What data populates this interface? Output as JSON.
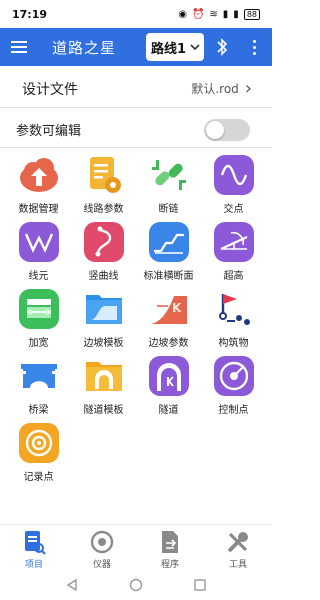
{
  "status": {
    "time": "17:19",
    "battery": "88"
  },
  "appbar": {
    "title": "道路之星",
    "route": "路线1"
  },
  "design": {
    "label": "设计文件",
    "value": "默认.rod"
  },
  "edit": {
    "label": "参数可编辑"
  },
  "grid": {
    "items": [
      {
        "label": "数据管理",
        "icon": "cloud-upload-icon"
      },
      {
        "label": "线路参数",
        "icon": "document-gear-icon"
      },
      {
        "label": "断链",
        "icon": "broken-chain-icon"
      },
      {
        "label": "交点",
        "icon": "sine-wave-icon"
      },
      {
        "label": "线元",
        "icon": "curve-line-icon"
      },
      {
        "label": "竖曲线",
        "icon": "vertical-curve-icon"
      },
      {
        "label": "标准横断面",
        "icon": "cross-section-icon"
      },
      {
        "label": "超高",
        "icon": "superelevation-icon"
      },
      {
        "label": "加宽",
        "icon": "widening-icon"
      },
      {
        "label": "边坡模板",
        "icon": "slope-template-icon"
      },
      {
        "label": "边坡参数",
        "icon": "slope-parameter-icon"
      },
      {
        "label": "构筑物",
        "icon": "structure-flag-icon"
      },
      {
        "label": "桥梁",
        "icon": "bridge-icon"
      },
      {
        "label": "隧道模板",
        "icon": "tunnel-template-icon"
      },
      {
        "label": "隧道",
        "icon": "tunnel-icon"
      },
      {
        "label": "控制点",
        "icon": "control-point-icon"
      },
      {
        "label": "记录点",
        "icon": "record-point-icon"
      }
    ]
  },
  "bottomnav": {
    "items": [
      {
        "label": "项目",
        "icon": "project-icon",
        "active": true
      },
      {
        "label": "仪器",
        "icon": "instrument-icon",
        "active": false
      },
      {
        "label": "程序",
        "icon": "program-icon",
        "active": false
      },
      {
        "label": "工具",
        "icon": "tools-icon",
        "active": false
      }
    ]
  },
  "colors": {
    "primary": "#2f6fe0",
    "toggle_off": "#d6d6d6"
  }
}
